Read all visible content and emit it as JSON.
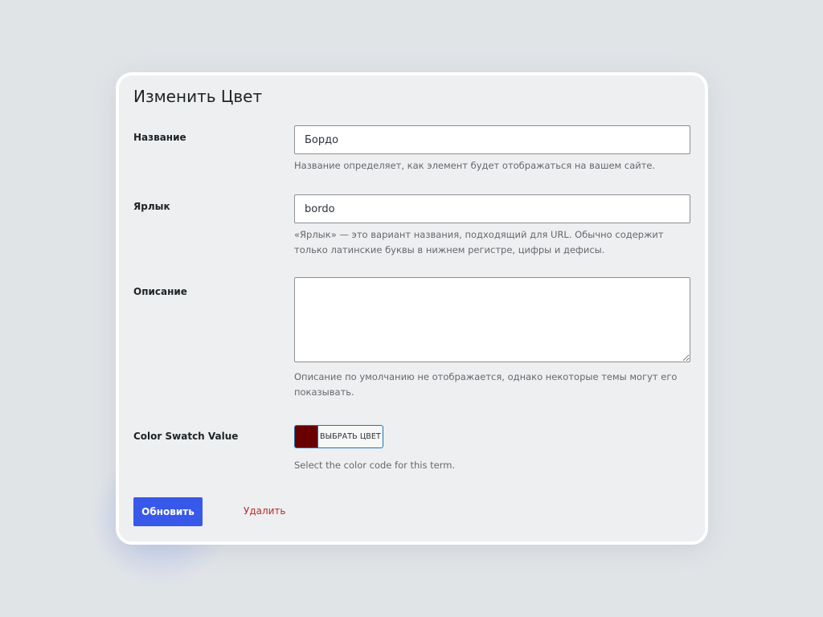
{
  "page": {
    "title": "Изменить Цвет"
  },
  "fields": {
    "name": {
      "label": "Название",
      "value": "Бордо",
      "description": "Название определяет, как элемент будет отображаться на вашем сайте."
    },
    "slug": {
      "label": "Ярлык",
      "value": "bordo",
      "description": "«Ярлык» — это вариант названия, подходящий для URL. Обычно содержит только латинские буквы в нижнем регистре, цифры и дефисы."
    },
    "description": {
      "label": "Описание",
      "value": "",
      "description": "Описание по умолчанию не отображается, однако некоторые темы могут его показывать."
    },
    "swatch": {
      "label": "Color Swatch Value",
      "button_label": "ВЫБРАТЬ ЦВЕТ",
      "color": "#680000",
      "description": "Select the color code for this term."
    }
  },
  "actions": {
    "update_label": "Обновить",
    "delete_label": "Удалить"
  },
  "colors": {
    "accent": "#3858e9",
    "danger": "#b32d2e"
  }
}
